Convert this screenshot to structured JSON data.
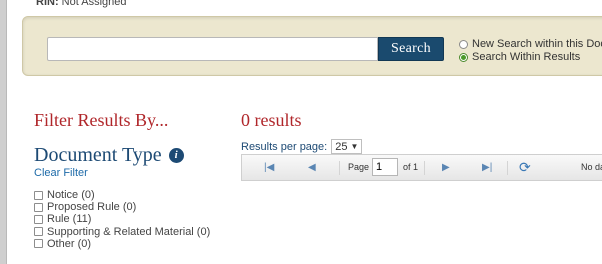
{
  "header": {
    "rin_label": "RIN:",
    "rin_value": "Not Assigned"
  },
  "search": {
    "input_value": "",
    "input_placeholder": "",
    "button_label": "Search",
    "options": [
      {
        "label": "New Search within this Docket",
        "selected": false
      },
      {
        "label": "Search Within Results",
        "selected": true
      }
    ]
  },
  "filters": {
    "heading": "Filter Results By...",
    "section_title": "Document Type",
    "clear_label": "Clear Filter",
    "items": [
      {
        "label": "Notice (0)"
      },
      {
        "label": "Proposed Rule (0)"
      },
      {
        "label": "Rule (11)"
      },
      {
        "label": "Supporting & Related Material (0)"
      },
      {
        "label": "Other (0)"
      }
    ]
  },
  "results": {
    "count_label": "0 results",
    "per_page_label": "Results per page:",
    "per_page_value": "25",
    "pager": {
      "page_label": "Page",
      "page_value": "1",
      "of_label": "of 1",
      "no_data_label": "No da"
    }
  },
  "colors": {
    "accent_red": "#b0262a",
    "accent_blue": "#1d4a74",
    "button_bg": "#1a4a6e",
    "panel_bg": "#ece7cf"
  }
}
